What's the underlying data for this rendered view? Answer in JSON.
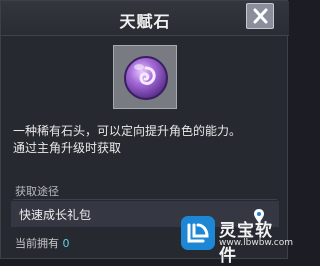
{
  "dialog": {
    "title": "天赋石",
    "close_icon": "close-x-icon"
  },
  "item": {
    "icon": "purple-talent-stone-icon",
    "description_line1": "一种稀有石头，可以定向提升角色的能力。",
    "description_line2": "通过主角升级时获取"
  },
  "acquisition": {
    "label": "获取途径",
    "source": "快速成长礼包"
  },
  "owned": {
    "label": "当前拥有",
    "count": "0"
  },
  "watermark": {
    "name": "灵宝软件",
    "url": "www.lbwbw.com"
  },
  "colors": {
    "panel": "#272930",
    "accent_count": "#5fd2e6",
    "watermark_blue": "#1d87d6",
    "gem_purple": "#a56bd8"
  }
}
